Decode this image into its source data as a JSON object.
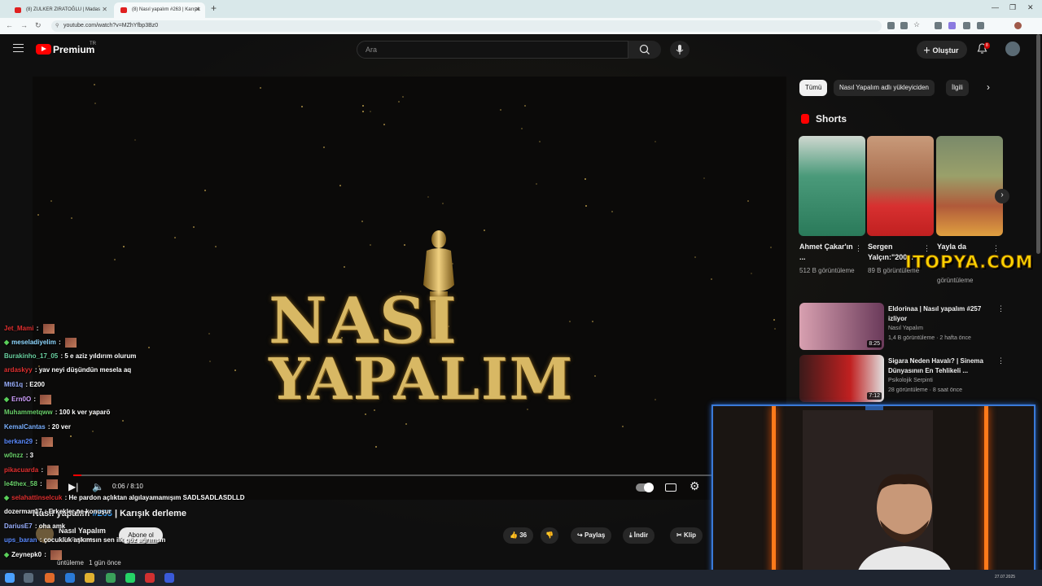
{
  "browser": {
    "tabs": [
      {
        "title": "(8) ZULKER ZIRATOĞLU | Madas"
      },
      {
        "title": "(8) Nasıl yapalım #263 | Karışık"
      }
    ],
    "url": "youtube.com/watch?v=MZhYfbp3Bz0"
  },
  "header": {
    "logo": "Premium",
    "logo_country": "TR",
    "search_placeholder": "Ara",
    "create_label": "Oluştur",
    "notification_count": "8"
  },
  "player": {
    "title_line1": "NASI",
    "title_line2": "YAPALIM",
    "time": "0:06 / 8:10",
    "progress": 0.012
  },
  "video": {
    "title": "Nasıl yapalım",
    "title_tag": "#263",
    "title_rest": "| Karışık derleme",
    "channel": "Nasıl Yapalım",
    "subscribers": "1,74 B abone",
    "subscribe_label": "Abone ol",
    "likes": "36",
    "share_label": "Paylaş",
    "download_label": "İndir",
    "clip_label": "Klip",
    "stats_suffix": "üntüleme",
    "stats_date": "1 gün önce"
  },
  "chips": [
    "Tümü",
    "Nasıl Yapalım adlı yükleyiciden",
    "İlgili"
  ],
  "shorts": {
    "heading": "Shorts",
    "items": [
      {
        "title": "Ahmet Çakar'ın ...",
        "views": "512 B görüntüleme"
      },
      {
        "title": "Sergen Yalçın:\"200...",
        "views": "89 B görüntüleme"
      },
      {
        "title": "Yayla da",
        "views": "görüntüleme"
      }
    ]
  },
  "recommendations": [
    {
      "title": "Eldorinaa | Nasıl yapalım #257 izliyor",
      "channel": "Nasıl Yapalım",
      "meta": "1,4 B görüntüleme · 2 hafta önce",
      "duration": "8:25"
    },
    {
      "title": "Sigara Neden Havalı? | Sinema Dünyasının En Tehlikeli ...",
      "channel": "Psikolojik Serpinti",
      "meta": "28 görüntüleme · 8 saat önce",
      "duration": "7:12"
    }
  ],
  "chat": [
    {
      "user": "Jet_Mami",
      "color": "#e03030",
      "text": "",
      "emote": true,
      "diamond": false
    },
    {
      "user": "meseladiyelim",
      "color": "#8fd8ff",
      "text": "",
      "emote": true,
      "diamond": true
    },
    {
      "user": "Burakinho_17_05",
      "color": "#6ad0a0",
      "text": "5 e aziz yıldırım olurum",
      "emote": false,
      "diamond": false
    },
    {
      "user": "ardaskyy",
      "color": "#e03030",
      "text": "yav neyi düşündün mesela aq",
      "emote": false,
      "diamond": false
    },
    {
      "user": "Mt61q",
      "color": "#9ab0ff",
      "text": "E200",
      "emote": false,
      "diamond": false
    },
    {
      "user": "Ern0O",
      "color": "#d0a0ff",
      "text": "",
      "emote": true,
      "diamond": true
    },
    {
      "user": "Muhammetqww",
      "color": "#6ad06a",
      "text": "100 k ver yaparö",
      "emote": false,
      "diamond": false
    },
    {
      "user": "KemalCantas",
      "color": "#7ab0ff",
      "text": "20 ver",
      "emote": false,
      "diamond": false
    },
    {
      "user": "berkan29",
      "color": "#5a8aff",
      "text": "",
      "emote": true,
      "diamond": false
    },
    {
      "user": "w0nzz",
      "color": "#6ad06a",
      "text": "3",
      "emote": false,
      "diamond": false
    },
    {
      "user": "pikacuarda",
      "color": "#e03030",
      "text": "",
      "emote": true,
      "diamond": false
    },
    {
      "user": "le4thex_58",
      "color": "#6ad06a",
      "text": "",
      "emote": true,
      "diamond": false
    },
    {
      "user": "selahattinselcuk",
      "color": "#e03030",
      "text": "He pardon açlıktan algılayamamışım SADLSADLASDLLD",
      "emote": false,
      "diamond": true
    },
    {
      "user": "dozerman17",
      "color": "#ffffff",
      "text": "Erkekler ne konuşur",
      "emote": false,
      "diamond": false
    },
    {
      "user": "DariusE7",
      "color": "#9ab0ff",
      "text": "oha amk",
      "emote": false,
      "diamond": false
    },
    {
      "user": "ups_baran",
      "color": "#5a8aff",
      "text": "çocukluk aşkımsın sen ilk göz ağrımsın",
      "emote": false,
      "diamond": false
    },
    {
      "user": "Zeynepk0",
      "color": "#ffffff",
      "text": "",
      "emote": true,
      "diamond": true
    }
  ],
  "watermark": "ITOPYA.COM",
  "taskbar": {
    "time": "27.07.2025"
  },
  "colors": {
    "accent": "#ff0000",
    "link": "#3ea6ff",
    "gold": "#d8b864",
    "cam_border": "#3a7ad8",
    "cam_light": "#ff7a1a"
  }
}
